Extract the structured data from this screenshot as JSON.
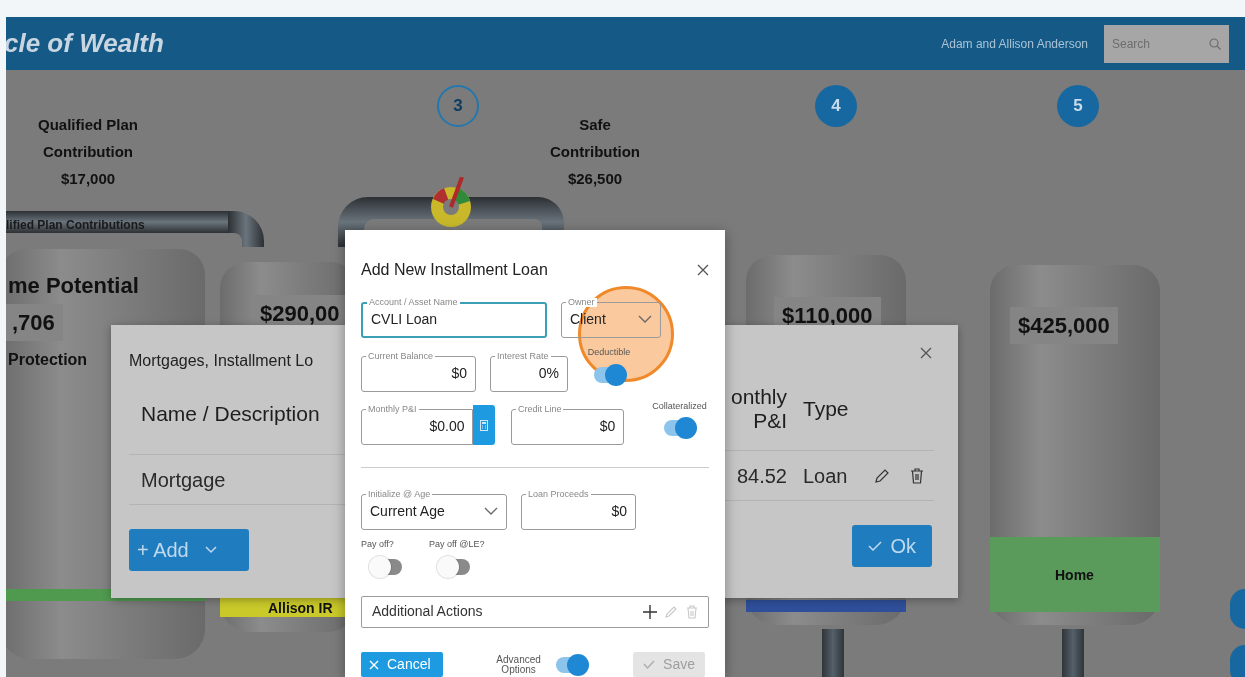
{
  "app": {
    "title": "cle of Wealth",
    "user": "Adam and Allison Anderson",
    "search_placeholder": "Search"
  },
  "steps": [
    {
      "number": "3",
      "kind": "outline"
    },
    {
      "number": "4",
      "kind": "filled"
    },
    {
      "number": "5",
      "kind": "filled"
    }
  ],
  "contributions": [
    {
      "title": "Qualified Plan Contribution",
      "amount": "$17,000"
    },
    {
      "title": "Safe Contribution",
      "amount": "$26,500"
    }
  ],
  "pipe_label": "lified Plan Contributions",
  "tanks": [
    {
      "heading": "me Potential",
      "amount": ",706",
      "caption": "Protection",
      "color": "#4f9a4f"
    },
    {
      "amount": "$290,00",
      "band_label": "Allison IR",
      "color": "#c9c92a"
    },
    {
      "amount": "$110,000",
      "color": "#2f4f9a"
    },
    {
      "amount": "$425,000",
      "band_label": "Home",
      "color": "#5a9a5a"
    }
  ],
  "loans_dialog": {
    "title": "Mortgages, Installment Lo",
    "columns": [
      "Name / Description",
      "onthly P&I",
      "Type"
    ],
    "rows": [
      {
        "cells": [
          "Mortgage",
          "84.52",
          "Loan"
        ]
      }
    ],
    "add_button": "+ Add",
    "ok_button": "Ok"
  },
  "add_loan_dialog": {
    "title": "Add New Installment Loan",
    "sections": [
      [
        [
          {
            "kind": "text",
            "label": "Account / Asset Name",
            "value": "CVLI Loan",
            "focused": true
          },
          {
            "kind": "select",
            "label": "Owner",
            "value": "Client",
            "focused": false
          }
        ],
        [
          {
            "kind": "number",
            "label": "Current Balance",
            "value": "$0",
            "focused": false
          },
          {
            "kind": "number",
            "label": "Interest Rate",
            "value": "0%",
            "focused": false
          },
          {
            "kind": "toggle",
            "label": "Deductible",
            "on": true
          }
        ],
        [
          {
            "kind": "calc",
            "label": "Monthly P&I",
            "value": "$0.00",
            "focused": false
          },
          {
            "kind": "number",
            "label": "Credit Line",
            "value": "$0",
            "focused": false
          },
          {
            "kind": "toggle",
            "label": "Collateralized",
            "on": true
          }
        ]
      ],
      [
        [
          {
            "kind": "select",
            "label": "Initialize @ Age",
            "value": "Current Age",
            "focused": false
          },
          {
            "kind": "number",
            "label": "Loan Proceeds",
            "value": "$0",
            "focused": false
          }
        ],
        [
          {
            "kind": "toggle",
            "label": "Pay off?",
            "on": false
          },
          {
            "kind": "toggle",
            "label": "Pay off @LE?",
            "on": false
          }
        ]
      ]
    ],
    "actions_box": {
      "label": "Additional Actions",
      "edit_disabled": true,
      "delete_disabled": true
    },
    "cancel_button": "Cancel",
    "advanced": {
      "label": "Advanced Options",
      "on": true
    },
    "save_button": {
      "label": "Save",
      "disabled": true
    }
  }
}
